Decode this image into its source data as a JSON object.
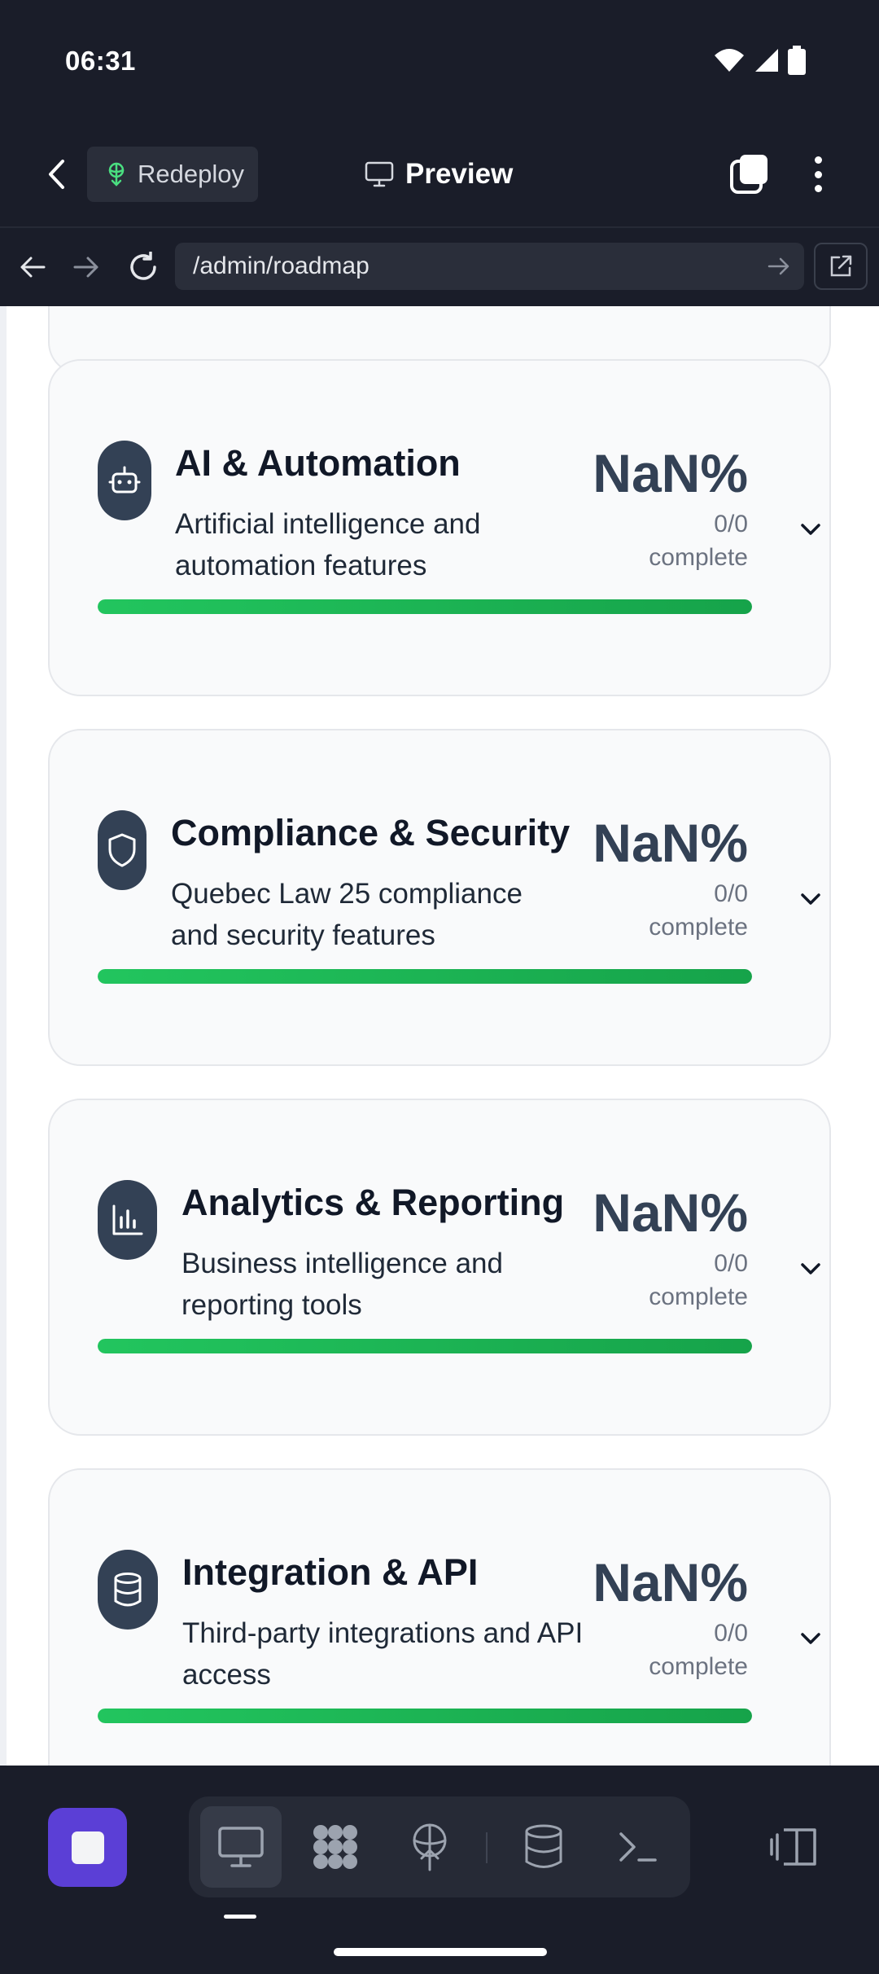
{
  "status_bar": {
    "time": "06:31"
  },
  "app_bar": {
    "redeploy_label": "Redeploy",
    "title": "Preview"
  },
  "browser": {
    "url": "/admin/roadmap"
  },
  "cards": [
    {
      "title": "AI & Automation",
      "description": "Artificial intelligence and automation features",
      "percent": "NaN%",
      "count": "0/0",
      "count_label": "complete",
      "icon": "robot-icon",
      "progress": 1.0
    },
    {
      "title": "Compliance & Security",
      "description": "Quebec Law 25 compliance and security features",
      "percent": "NaN%",
      "count": "0/0",
      "count_label": "complete",
      "icon": "shield-icon",
      "progress": 1.0
    },
    {
      "title": "Analytics & Reporting",
      "description": "Business intelligence and reporting tools",
      "percent": "NaN%",
      "count": "0/0",
      "count_label": "complete",
      "icon": "bar-chart-icon",
      "progress": 1.0
    },
    {
      "title": "Integration & API",
      "description": "Third-party integrations and API access",
      "percent": "NaN%",
      "count": "0/0",
      "count_label": "complete",
      "icon": "database-icon",
      "progress": 1.0
    }
  ],
  "colors": {
    "accent": "#5b3fd6",
    "progress": "#22c55e",
    "icon_bg": "#334155",
    "chrome_bg": "#1a1d29"
  },
  "dock": {
    "tools": [
      "monitor-icon",
      "apps-icon",
      "deploy-icon",
      "database-icon",
      "terminal-icon"
    ],
    "active_tool": "monitor-icon"
  }
}
